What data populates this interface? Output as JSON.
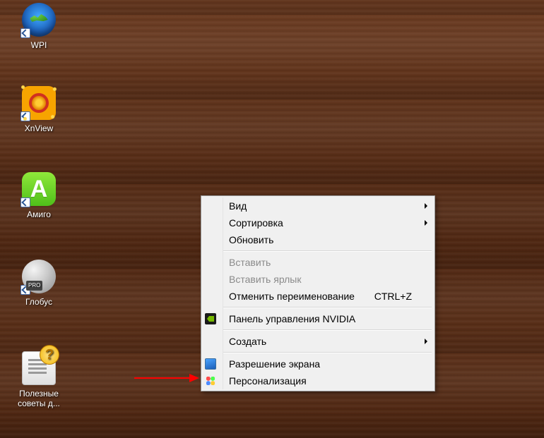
{
  "desktop_icons": [
    {
      "id": "wpi",
      "label": "WPI"
    },
    {
      "id": "xnview",
      "label": "XnView"
    },
    {
      "id": "amigo",
      "label": "Амиго"
    },
    {
      "id": "globus",
      "label": "Глобус"
    },
    {
      "id": "help",
      "label": "Полезные советы д..."
    }
  ],
  "context_menu": {
    "items": [
      {
        "label": "Вид",
        "submenu": true
      },
      {
        "label": "Сортировка",
        "submenu": true
      },
      {
        "label": "Обновить"
      },
      {
        "sep": true
      },
      {
        "label": "Вставить",
        "disabled": true
      },
      {
        "label": "Вставить ярлык",
        "disabled": true
      },
      {
        "label": "Отменить переименование",
        "shortcut": "CTRL+Z"
      },
      {
        "sep": true
      },
      {
        "label": "Панель управления NVIDIA",
        "icon": "nvidia"
      },
      {
        "sep": true
      },
      {
        "label": "Создать",
        "submenu": true
      },
      {
        "sep": true
      },
      {
        "label": "Разрешение экрана",
        "icon": "resolution"
      },
      {
        "label": "Персонализация",
        "icon": "personalize"
      }
    ]
  }
}
